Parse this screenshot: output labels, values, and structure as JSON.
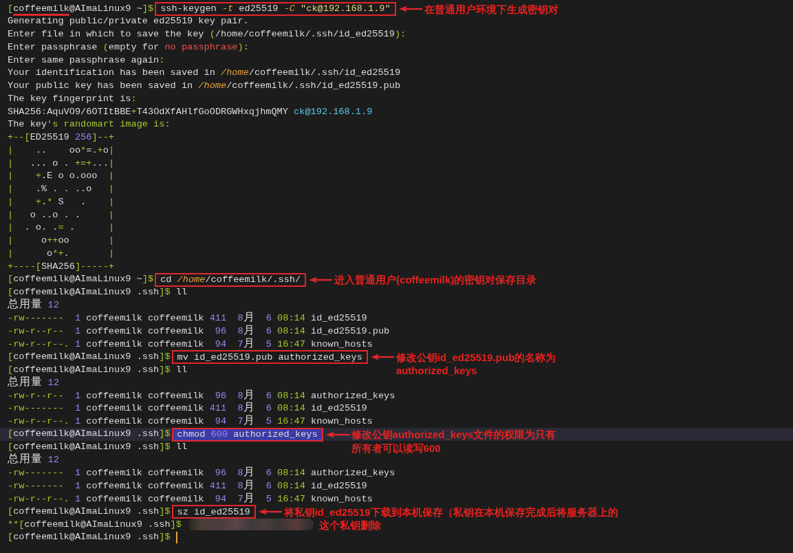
{
  "terminal": {
    "lines": [
      {
        "kind": "command",
        "segments": [
          {
            "text": "[",
            "kind": "syntax"
          },
          {
            "text": "coffeemilk",
            "kind": "underlined"
          },
          {
            "text": "@AImaLinux9 ~",
            "kind": "text"
          },
          {
            "text": "]$",
            "kind": "syntax"
          }
        ],
        "command": {
          "selected": false,
          "segments": [
            {
              "text": "ssh-keygen ",
              "kind": "text"
            },
            {
              "text": "-t",
              "kind": "emphasis"
            },
            {
              "text": " ed25519 ",
              "kind": "text"
            },
            {
              "text": "-C",
              "kind": "emphasis"
            },
            {
              "text": " \"ck@192.168.1.9\"",
              "kind": "string"
            }
          ]
        },
        "note": {
          "lines": [
            "在普通用户环境下生成密钥对"
          ]
        }
      },
      {
        "kind": "text",
        "segments": [
          {
            "text": "Generating public/private ed25519 key pair.",
            "kind": "text"
          }
        ]
      },
      {
        "kind": "text",
        "segments": [
          {
            "text": "Enter file in which to save the key ",
            "kind": "text"
          },
          {
            "text": "(",
            "kind": "syntax"
          },
          {
            "text": "/home/coffeemilk/.ssh/id_ed25519",
            "kind": "text"
          },
          {
            "text": "):",
            "kind": "syntax"
          }
        ]
      },
      {
        "kind": "text",
        "segments": [
          {
            "text": "Enter passphrase ",
            "kind": "text"
          },
          {
            "text": "(",
            "kind": "syntax"
          },
          {
            "text": "empty for ",
            "kind": "text"
          },
          {
            "text": "no passphrase",
            "kind": "warning"
          },
          {
            "text": "):",
            "kind": "syntax"
          }
        ]
      },
      {
        "kind": "text",
        "segments": [
          {
            "text": "Enter same passphrase again",
            "kind": "text"
          },
          {
            "text": ":",
            "kind": "syntax"
          }
        ]
      },
      {
        "kind": "text",
        "segments": [
          {
            "text": "Your identification has been saved in ",
            "kind": "text"
          },
          {
            "text": "/home",
            "kind": "emphasis"
          },
          {
            "text": "/coffeemilk/.ssh/id_ed25519",
            "kind": "text"
          }
        ]
      },
      {
        "kind": "text",
        "segments": [
          {
            "text": "Your public key has been saved in ",
            "kind": "text"
          },
          {
            "text": "/home",
            "kind": "emphasis"
          },
          {
            "text": "/coffeemilk/.ssh/id_ed25519.pub",
            "kind": "text"
          }
        ]
      },
      {
        "kind": "text",
        "segments": [
          {
            "text": "The key fingerprint is",
            "kind": "text"
          },
          {
            "text": ":",
            "kind": "syntax"
          }
        ]
      },
      {
        "kind": "text",
        "segments": [
          {
            "text": "SHA256",
            "kind": "text"
          },
          {
            "text": ":",
            "kind": "syntax"
          },
          {
            "text": "AquVO9/6OTItBBE",
            "kind": "text"
          },
          {
            "text": "+",
            "kind": "syntax"
          },
          {
            "text": "T43OdXfAHlfGoODRGWHxqjhmQMY ",
            "kind": "text"
          },
          {
            "text": "ck@192.168.1.9",
            "kind": "host"
          }
        ]
      },
      {
        "kind": "text",
        "segments": [
          {
            "text": "The key",
            "kind": "text"
          },
          {
            "text": "'s randomart image is:",
            "kind": "syntax"
          }
        ]
      },
      {
        "kind": "text",
        "segments": [
          {
            "text": "+--[",
            "kind": "syntax"
          },
          {
            "text": "ED25519 ",
            "kind": "text"
          },
          {
            "text": "256",
            "kind": "number"
          },
          {
            "text": "]--+",
            "kind": "syntax"
          }
        ]
      },
      {
        "kind": "text",
        "segments": [
          {
            "text": "|",
            "kind": "syntax"
          },
          {
            "text": "    ..    oo",
            "kind": "text"
          },
          {
            "text": "*",
            "kind": "syntax"
          },
          {
            "text": "=.",
            "kind": "text"
          },
          {
            "text": "+",
            "kind": "syntax"
          },
          {
            "text": "o",
            "kind": "text"
          },
          {
            "text": "|",
            "kind": "syntax"
          }
        ]
      },
      {
        "kind": "text",
        "segments": [
          {
            "text": "|",
            "kind": "syntax"
          },
          {
            "text": "   ... o . ",
            "kind": "text"
          },
          {
            "text": "+=+",
            "kind": "syntax"
          },
          {
            "text": "...",
            "kind": "text"
          },
          {
            "text": "|",
            "kind": "syntax"
          }
        ]
      },
      {
        "kind": "text",
        "segments": [
          {
            "text": "|    +",
            "kind": "syntax"
          },
          {
            "text": ".E o o.ooo  ",
            "kind": "text"
          },
          {
            "text": "|",
            "kind": "syntax"
          }
        ]
      },
      {
        "kind": "text",
        "segments": [
          {
            "text": "|",
            "kind": "syntax"
          },
          {
            "text": "    .% . . ..o   ",
            "kind": "text"
          },
          {
            "text": "|",
            "kind": "syntax"
          }
        ]
      },
      {
        "kind": "text",
        "segments": [
          {
            "text": "|    +",
            "kind": "syntax"
          },
          {
            "text": ".",
            "kind": "text"
          },
          {
            "text": "*",
            "kind": "syntax"
          },
          {
            "text": " S   .    ",
            "kind": "text"
          },
          {
            "text": "|",
            "kind": "syntax"
          }
        ]
      },
      {
        "kind": "text",
        "segments": [
          {
            "text": "|",
            "kind": "syntax"
          },
          {
            "text": "   o ..o . .     ",
            "kind": "text"
          },
          {
            "text": "|",
            "kind": "syntax"
          }
        ]
      },
      {
        "kind": "text",
        "segments": [
          {
            "text": "|",
            "kind": "syntax"
          },
          {
            "text": "  . o. .",
            "kind": "text"
          },
          {
            "text": "=",
            "kind": "syntax"
          },
          {
            "text": " .      ",
            "kind": "text"
          },
          {
            "text": "|",
            "kind": "syntax"
          }
        ]
      },
      {
        "kind": "text",
        "segments": [
          {
            "text": "|",
            "kind": "syntax"
          },
          {
            "text": "     o",
            "kind": "text"
          },
          {
            "text": "++",
            "kind": "syntax"
          },
          {
            "text": "oo       ",
            "kind": "text"
          },
          {
            "text": "|",
            "kind": "syntax"
          }
        ]
      },
      {
        "kind": "text",
        "segments": [
          {
            "text": "|",
            "kind": "syntax"
          },
          {
            "text": "      o",
            "kind": "text"
          },
          {
            "text": "*+",
            "kind": "syntax"
          },
          {
            "text": ".       ",
            "kind": "text"
          },
          {
            "text": "|",
            "kind": "syntax"
          }
        ]
      },
      {
        "kind": "text",
        "segments": [
          {
            "text": "+----[",
            "kind": "syntax"
          },
          {
            "text": "SHA256",
            "kind": "text"
          },
          {
            "text": "]-----+",
            "kind": "syntax"
          }
        ]
      },
      {
        "kind": "command",
        "segments": [
          {
            "text": "[",
            "kind": "syntax"
          },
          {
            "text": "coffeemilk@AImaLinux9 ~",
            "kind": "text"
          },
          {
            "text": "]$",
            "kind": "syntax"
          }
        ],
        "command": {
          "selected": false,
          "segments": [
            {
              "text": "cd ",
              "kind": "text"
            },
            {
              "text": "/home",
              "kind": "emphasis"
            },
            {
              "text": "/coffeemilk/.ssh/",
              "kind": "text"
            }
          ]
        },
        "note": {
          "lines": [
            "进入普通用户(coffeemilk)的密钥对保存目录"
          ]
        }
      },
      {
        "kind": "text",
        "segments": [
          {
            "text": "[",
            "kind": "syntax"
          },
          {
            "text": "coffeemilk@AImaLinux9 .ssh",
            "kind": "text"
          },
          {
            "text": "]$",
            "kind": "syntax"
          },
          {
            "text": " ll",
            "kind": "text"
          }
        ]
      },
      {
        "kind": "text",
        "segments": [
          {
            "text": "总用量 ",
            "kind": "text"
          },
          {
            "text": "12",
            "kind": "number"
          }
        ]
      },
      {
        "kind": "text",
        "segments": [
          {
            "text": "-rw-------",
            "kind": "syntax"
          },
          {
            "text": "  1",
            "kind": "number"
          },
          {
            "text": " coffeemilk coffeemilk ",
            "kind": "text"
          },
          {
            "text": "411",
            "kind": "number"
          },
          {
            "text": "  8",
            "kind": "number"
          },
          {
            "text": "月",
            "kind": "text"
          },
          {
            "text": "  6",
            "kind": "number"
          },
          {
            "text": " 08:14",
            "kind": "syntax"
          },
          {
            "text": " id_ed25519",
            "kind": "text"
          }
        ]
      },
      {
        "kind": "text",
        "segments": [
          {
            "text": "-rw-r--r--",
            "kind": "syntax"
          },
          {
            "text": "  1",
            "kind": "number"
          },
          {
            "text": " coffeemilk coffeemilk ",
            "kind": "text"
          },
          {
            "text": " 96",
            "kind": "number"
          },
          {
            "text": "  8",
            "kind": "number"
          },
          {
            "text": "月",
            "kind": "text"
          },
          {
            "text": "  6",
            "kind": "number"
          },
          {
            "text": " 08:14",
            "kind": "syntax"
          },
          {
            "text": " id_ed25519.pub",
            "kind": "text"
          }
        ]
      },
      {
        "kind": "text",
        "segments": [
          {
            "text": "-rw-r--r--.",
            "kind": "syntax"
          },
          {
            "text": " 1",
            "kind": "number"
          },
          {
            "text": " coffeemilk coffeemilk ",
            "kind": "text"
          },
          {
            "text": " 94",
            "kind": "number"
          },
          {
            "text": "  7",
            "kind": "number"
          },
          {
            "text": "月",
            "kind": "text"
          },
          {
            "text": "  5",
            "kind": "number"
          },
          {
            "text": " 16:47",
            "kind": "syntax"
          },
          {
            "text": " known_hosts",
            "kind": "text"
          }
        ]
      },
      {
        "kind": "command",
        "segments": [
          {
            "text": "[",
            "kind": "syntax"
          },
          {
            "text": "coffeemilk@AImaLinux9 .ssh",
            "kind": "text"
          },
          {
            "text": "]$",
            "kind": "syntax"
          }
        ],
        "command": {
          "selected": false,
          "segments": [
            {
              "text": "mv id_ed25519.pub authorized_keys",
              "kind": "text"
            }
          ]
        },
        "note": {
          "lines": [
            "修改公钥id_ed25519.pub的名称为",
            "authorized_keys"
          ]
        }
      },
      {
        "kind": "text",
        "segments": [
          {
            "text": "[",
            "kind": "syntax"
          },
          {
            "text": "coffeemilk@AImaLinux9 .ssh",
            "kind": "text"
          },
          {
            "text": "]$",
            "kind": "syntax"
          },
          {
            "text": " ll",
            "kind": "text"
          }
        ]
      },
      {
        "kind": "text",
        "segments": [
          {
            "text": "总用量 ",
            "kind": "text"
          },
          {
            "text": "12",
            "kind": "number"
          }
        ]
      },
      {
        "kind": "text",
        "segments": [
          {
            "text": "-rw-r--r--",
            "kind": "syntax"
          },
          {
            "text": "  1",
            "kind": "number"
          },
          {
            "text": " coffeemilk coffeemilk ",
            "kind": "text"
          },
          {
            "text": " 96",
            "kind": "number"
          },
          {
            "text": "  8",
            "kind": "number"
          },
          {
            "text": "月",
            "kind": "text"
          },
          {
            "text": "  6",
            "kind": "number"
          },
          {
            "text": " 08:14",
            "kind": "syntax"
          },
          {
            "text": " authorized_keys",
            "kind": "text"
          }
        ]
      },
      {
        "kind": "text",
        "segments": [
          {
            "text": "-rw-------",
            "kind": "syntax"
          },
          {
            "text": "  1",
            "kind": "number"
          },
          {
            "text": " coffeemilk coffeemilk ",
            "kind": "text"
          },
          {
            "text": "411",
            "kind": "number"
          },
          {
            "text": "  8",
            "kind": "number"
          },
          {
            "text": "月",
            "kind": "text"
          },
          {
            "text": "  6",
            "kind": "number"
          },
          {
            "text": " 08:14",
            "kind": "syntax"
          },
          {
            "text": " id_ed25519",
            "kind": "text"
          }
        ]
      },
      {
        "kind": "text",
        "segments": [
          {
            "text": "-rw-r--r--.",
            "kind": "syntax"
          },
          {
            "text": " 1",
            "kind": "number"
          },
          {
            "text": " coffeemilk coffeemilk ",
            "kind": "text"
          },
          {
            "text": " 94",
            "kind": "number"
          },
          {
            "text": "  7",
            "kind": "number"
          },
          {
            "text": "月",
            "kind": "text"
          },
          {
            "text": "  5",
            "kind": "number"
          },
          {
            "text": " 16:47",
            "kind": "syntax"
          },
          {
            "text": " known_hosts",
            "kind": "text"
          }
        ]
      },
      {
        "kind": "command",
        "segments": [
          {
            "text": "[",
            "kind": "syntax"
          },
          {
            "text": "coffeemilk@AImaLinux9 .ssh",
            "kind": "text"
          },
          {
            "text": "]$",
            "kind": "syntax"
          }
        ],
        "command": {
          "selected": true,
          "segments": [
            {
              "text": "chmod ",
              "kind": "text"
            },
            {
              "text": "600",
              "kind": "number"
            },
            {
              "text": " authorized_keys",
              "kind": "text"
            }
          ]
        },
        "note": {
          "lines": [
            "修改公钥authorized_keys文件的权限为只有",
            "所有者可以读写600"
          ]
        }
      },
      {
        "kind": "text",
        "segments": [
          {
            "text": "[",
            "kind": "syntax"
          },
          {
            "text": "coffeemilk@AImaLinux9 .ssh",
            "kind": "text"
          },
          {
            "text": "]$",
            "kind": "syntax"
          },
          {
            "text": " ll",
            "kind": "text"
          }
        ]
      },
      {
        "kind": "text",
        "segments": [
          {
            "text": "总用量 ",
            "kind": "text"
          },
          {
            "text": "12",
            "kind": "number"
          }
        ]
      },
      {
        "kind": "text",
        "segments": [
          {
            "text": "-rw-------",
            "kind": "syntax"
          },
          {
            "text": "  1",
            "kind": "number"
          },
          {
            "text": " coffeemilk coffeemilk ",
            "kind": "text"
          },
          {
            "text": " 96",
            "kind": "number"
          },
          {
            "text": "  8",
            "kind": "number"
          },
          {
            "text": "月",
            "kind": "text"
          },
          {
            "text": "  6",
            "kind": "number"
          },
          {
            "text": " 08:14",
            "kind": "syntax"
          },
          {
            "text": " authorized_keys",
            "kind": "text"
          }
        ]
      },
      {
        "kind": "text",
        "segments": [
          {
            "text": "-rw-------",
            "kind": "syntax"
          },
          {
            "text": "  1",
            "kind": "number"
          },
          {
            "text": " coffeemilk coffeemilk ",
            "kind": "text"
          },
          {
            "text": "411",
            "kind": "number"
          },
          {
            "text": "  8",
            "kind": "number"
          },
          {
            "text": "月",
            "kind": "text"
          },
          {
            "text": "  6",
            "kind": "number"
          },
          {
            "text": " 08:14",
            "kind": "syntax"
          },
          {
            "text": " id_ed25519",
            "kind": "text"
          }
        ]
      },
      {
        "kind": "text",
        "segments": [
          {
            "text": "-rw-r--r--.",
            "kind": "syntax"
          },
          {
            "text": " 1",
            "kind": "number"
          },
          {
            "text": " coffeemilk coffeemilk ",
            "kind": "text"
          },
          {
            "text": " 94",
            "kind": "number"
          },
          {
            "text": "  7",
            "kind": "number"
          },
          {
            "text": "月",
            "kind": "text"
          },
          {
            "text": "  5",
            "kind": "number"
          },
          {
            "text": " 16:47",
            "kind": "syntax"
          },
          {
            "text": " known_hosts",
            "kind": "text"
          }
        ]
      },
      {
        "kind": "command",
        "segments": [
          {
            "text": "[",
            "kind": "syntax"
          },
          {
            "text": "coffeemilk@AImaLinux9 .ssh",
            "kind": "text"
          },
          {
            "text": "]$",
            "kind": "syntax"
          }
        ],
        "command": {
          "selected": false,
          "segments": [
            {
              "text": "sz id_ed25519",
              "kind": "text"
            }
          ]
        },
        "note": {
          "lines": [
            "将私钥id_ed25519下载到本机保存（私钥在本机保存完成后将服务器上的"
          ]
        }
      },
      {
        "kind": "redacted",
        "segments": [
          {
            "text": "**[",
            "kind": "syntax"
          },
          {
            "text": "coffeemilk@AImaLinux9 .ssh",
            "kind": "text"
          },
          {
            "text": "]$",
            "kind": "syntax"
          }
        ],
        "note": {
          "lines": [
            "这个私钥删除"
          ]
        }
      },
      {
        "kind": "input",
        "segments": [
          {
            "text": "[",
            "kind": "syntax"
          },
          {
            "text": "coffeemilk@AImaLinux9 .ssh",
            "kind": "text"
          },
          {
            "text": "]$",
            "kind": "syntax"
          }
        ]
      }
    ]
  }
}
